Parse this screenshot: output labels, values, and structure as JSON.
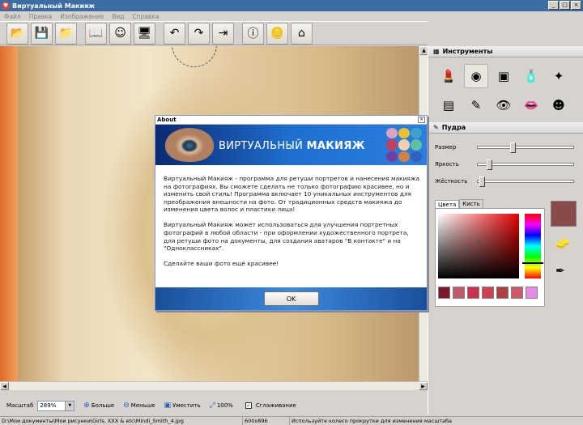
{
  "window": {
    "title": "Виртуальный Макияж"
  },
  "menu": [
    "Файл",
    "Правка",
    "Изображение",
    "Вид",
    "Справка"
  ],
  "toolbar": {
    "buttons": [
      {
        "name": "open-folder-icon",
        "glyph": "📂"
      },
      {
        "name": "save-icon",
        "glyph": "💾"
      },
      {
        "name": "open-file-icon",
        "glyph": "📁"
      },
      {
        "name": "book-icon",
        "glyph": "📖"
      },
      {
        "name": "smiley-icon",
        "glyph": "☺"
      },
      {
        "name": "monitor-icon",
        "glyph": "🖥"
      },
      {
        "name": "undo-icon",
        "glyph": "↶"
      },
      {
        "name": "redo-icon",
        "glyph": "↷"
      },
      {
        "name": "export-icon",
        "glyph": "⇥"
      },
      {
        "name": "info-icon",
        "glyph": "ⓘ"
      },
      {
        "name": "coins-icon",
        "glyph": "🪙"
      },
      {
        "name": "home-icon",
        "glyph": "⌂"
      }
    ]
  },
  "right_panel": {
    "tools_title": "Инструменты",
    "tools": [
      {
        "name": "lipstick-tool-icon",
        "glyph": "💄"
      },
      {
        "name": "powder-tool-icon",
        "glyph": "◉"
      },
      {
        "name": "blush-tool-icon",
        "glyph": "▣"
      },
      {
        "name": "foundation-tool-icon",
        "glyph": "🧴"
      },
      {
        "name": "hair-tool-icon",
        "glyph": "✦"
      },
      {
        "name": "eyeshadow-tool-icon",
        "glyph": "▤"
      },
      {
        "name": "pencil-tool-icon",
        "glyph": "✎"
      },
      {
        "name": "eye-tool-icon",
        "glyph": "👁"
      },
      {
        "name": "lips-tool-icon",
        "glyph": "👄"
      },
      {
        "name": "face-tool-icon",
        "glyph": "☻"
      }
    ],
    "section_title": "Пудра",
    "sliders": [
      {
        "label": "Размер",
        "value": 0.35
      },
      {
        "label": "Яркость",
        "value": 0.1
      },
      {
        "label": "Жёсткость",
        "value": 0.02
      }
    ],
    "tabs": [
      "Цвета",
      "Кисть"
    ],
    "swatches": [
      "#7a1a2a",
      "#c05a6a",
      "#d03050",
      "#d04050",
      "#b04040",
      "#d05a6a",
      "#e88ae8"
    ],
    "current_color": "#8b4a4a"
  },
  "dialog": {
    "title": "About",
    "brand_light": "ВИРТУАЛЬНЫЙ ",
    "brand_bold": "МАКИЯЖ",
    "paragraph1": "Виртуальный Макияж - программа для ретуши портретов и нанесения макияжа на фотографиях. Вы сможете сделать не только фотографию красивее, но и изменить свой стиль! Программа включает 10 уникальных инструментов для преображения внешности на фото. От традиционных средств макияжа до изменения цвета волос и пластики лица!",
    "paragraph2": "Виртуальный Макияж может использоваться для улучшения портретных фотографий в любой области - при оформлении художественного портрета, для ретуши фото на документы, для создания аватаров \"В контакте\" и на \"Одноклассниках\".",
    "paragraph3": "Сделайте ваши фото ещё красивее!",
    "ok_label": "OK"
  },
  "bottom": {
    "zoom_label": "Масштаб",
    "zoom_value": "289%",
    "zoom_in": "Больше",
    "zoom_out": "Меньше",
    "fit": "Уместить",
    "actual": "100%",
    "smooth_label": "Сглаживание",
    "smooth_checked": true
  },
  "status": {
    "path": "D:\\Мои документы\\Мои рисунки\\Girls, XXX & etc\\Mindi_Smith_4.jpg",
    "size": "600x896",
    "hint": "Используйте колесо прокрутки для изменения масштаба"
  }
}
